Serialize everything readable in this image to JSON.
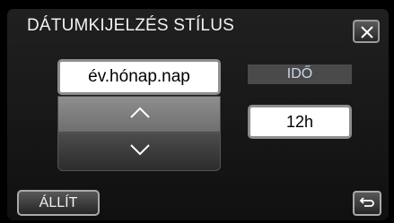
{
  "header": {
    "title": "DÁTUMKIJELZÉS STÍLUS",
    "close_icon": "close-icon"
  },
  "date_format": {
    "value": "év.hónap.nap",
    "up_icon": "chevron-up-icon",
    "down_icon": "chevron-down-icon"
  },
  "time": {
    "label": "IDŐ",
    "value": "12h"
  },
  "footer": {
    "set_label": "ÁLLÍT",
    "back_icon": "return-icon"
  }
}
